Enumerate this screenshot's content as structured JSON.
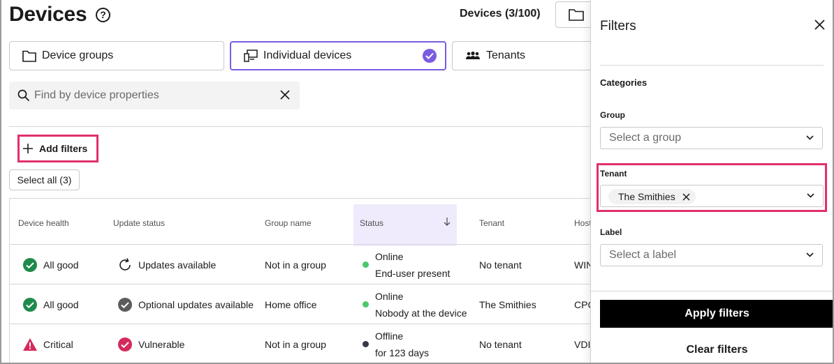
{
  "page": {
    "title": "Devices",
    "devices_count": "Devices (3/100)"
  },
  "tabs": [
    {
      "label": "Device groups",
      "icon": "folder-icon",
      "selected": false
    },
    {
      "label": "Individual devices",
      "icon": "devices-icon",
      "selected": true
    },
    {
      "label": "Tenants",
      "icon": "people-icon",
      "selected": false
    }
  ],
  "search": {
    "placeholder": "Find by device properties",
    "value": ""
  },
  "toolbar": {
    "add_filters": "Add filters",
    "select_all": "Select all (3)"
  },
  "table": {
    "columns": [
      "Device health",
      "Update status",
      "Group name",
      "Status",
      "Tenant",
      "Host"
    ],
    "sorted_column": "Status",
    "rows": [
      {
        "health": "All good",
        "health_icon": "check-circle-icon",
        "update": "Updates available",
        "update_icon": "refresh-icon",
        "group": "Not in a group",
        "status": "Online",
        "status_sub": "End-user present",
        "status_color": "#4cc76a",
        "tenant": "No tenant",
        "host": "WIN"
      },
      {
        "health": "All good",
        "health_icon": "check-circle-icon",
        "update": "Optional updates available",
        "update_icon": "check-circle-gray-icon",
        "group": "Home office",
        "status": "Online",
        "status_sub": "Nobody at the device",
        "status_color": "#4cc76a",
        "tenant": "The Smithies",
        "host": "CPC"
      },
      {
        "health": "Critical",
        "health_icon": "warning-triangle-icon",
        "update": "Vulnerable",
        "update_icon": "check-circle-red-icon",
        "group": "Not in a group",
        "status": "Offline",
        "status_sub": "for 123 days",
        "status_color": "#333a44",
        "tenant": "No tenant",
        "host": "VDI-"
      }
    ]
  },
  "filters_panel": {
    "title": "Filters",
    "categories_label": "Categories",
    "group": {
      "label": "Group",
      "placeholder": "Select a group"
    },
    "tenant": {
      "label": "Tenant",
      "chip": "The Smithies"
    },
    "label": {
      "label": "Label",
      "placeholder": "Select a label"
    },
    "apply": "Apply filters",
    "clear": "Clear filters"
  },
  "colors": {
    "accent": "#7b5ce0",
    "highlight": "#e0306a",
    "good": "#1f8a4c",
    "critical": "#d42a5b"
  }
}
